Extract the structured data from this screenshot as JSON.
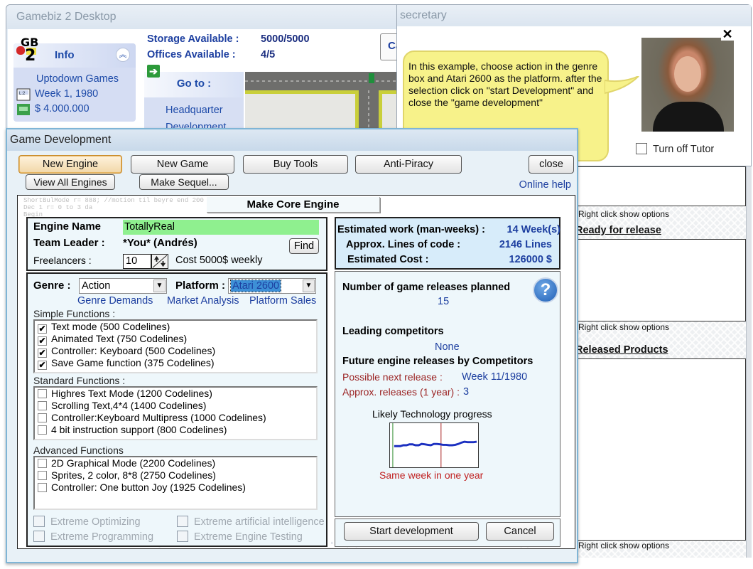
{
  "desktop": {
    "title": "Gamebiz 2 Desktop",
    "info": {
      "title": "Info",
      "company": "Uptodown Games",
      "date": "Week 1, 1980",
      "money": "$ 4.000.000"
    },
    "storage_label": "Storage Available :",
    "storage_value": "5000/5000",
    "offices_label": "Offices Available :",
    "offices_value": "4/5",
    "cal_button": "Ca",
    "goto": {
      "title": "Go to :",
      "items": [
        "Headquarter",
        "Development"
      ]
    }
  },
  "secretary": {
    "title": "secretary",
    "message": "In this example, choose action in the genre box and Atari 2600 as the platform. after the selection click on \"start Development\" and close the \"game development\"",
    "close": "✕",
    "tutor_toggle": "Turn off Tutor",
    "tutor_checked": false
  },
  "right_panel": {
    "hint": "Right click show options",
    "ready_title": "Ready for release",
    "released_title": "Released Products"
  },
  "game_dev": {
    "title": "Game Development",
    "toolbar": {
      "new_engine": "New Engine",
      "new_game": "New Game",
      "buy_tools": "Buy Tools",
      "anti_piracy": "Anti-Piracy",
      "close": "close",
      "view_all_engines": "View All Engines",
      "make_sequel": "Make Sequel...",
      "online_help": "Online help"
    },
    "section_title": "Make Core Engine",
    "engine": {
      "name_label": "Engine Name",
      "name_value": "TotallyReal",
      "leader_label": "Team Leader :",
      "leader_value": "*You* (Andrés)",
      "find": "Find",
      "freelancers_label": "Freelancers :",
      "freelancers_value": "10",
      "cost": "Cost 5000$ weekly"
    },
    "genre_label": "Genre :",
    "genre_value": "Action",
    "platform_label": "Platform :",
    "platform_value": "Atari 2600",
    "links": {
      "genre_demands": "Genre Demands",
      "market_analysis": "Market Analysis",
      "platform_sales": "Platform Sales"
    },
    "simple_label": "Simple Functions :",
    "simple": [
      {
        "label": "Text mode (500 Codelines)",
        "checked": true
      },
      {
        "label": "Animated Text (750 Codelines)",
        "checked": true
      },
      {
        "label": "Controller: Keyboard (500 Codelines)",
        "checked": true
      },
      {
        "label": "Save Game function (375 Codelines)",
        "checked": true
      }
    ],
    "standard_label": "Standard Functions :",
    "standard": [
      {
        "label": "Highres Text Mode (1200 Codelines)",
        "checked": false
      },
      {
        "label": "Scrolling Text,4*4 (1400 Codelines)",
        "checked": false
      },
      {
        "label": "Controller:Keyboard Multipress (1000 Codelines)",
        "checked": false
      },
      {
        "label": "4 bit instruction support (800 Codelines)",
        "checked": false
      }
    ],
    "advanced_label": "Advanced Functions",
    "advanced": [
      {
        "label": "2D Graphical Mode (2200 Codelines)",
        "checked": false
      },
      {
        "label": "Sprites, 2 color, 8*8 (2750 Codelines)",
        "checked": false
      },
      {
        "label": "Controller: One button Joy (1925 Codelines)",
        "checked": false
      }
    ],
    "extreme": {
      "optimizing": "Extreme Optimizing",
      "ai": "Extreme artificial intelligence",
      "programming": "Extreme Programming",
      "testing": "Extreme Engine Testing"
    },
    "estimates": {
      "work_label": "Estimated work (man-weeks) :",
      "work_value": "14 Week(s)",
      "lines_label": "Approx. Lines of code :",
      "lines_value": "2146 Lines",
      "cost_label": "Estimated Cost :",
      "cost_value": "126000 $"
    },
    "competition": {
      "releases_label": "Number of game releases planned",
      "releases_value": "15",
      "help": "?",
      "leading_label": "Leading competitors",
      "leading_value": "None",
      "future_label": "Future engine releases by Competitors",
      "next_label": "Possible next release :",
      "next_value": "Week 11/1980",
      "approx_label": "Approx. releases (1 year) :",
      "approx_value": "3",
      "chart_title": "Likely Technology progress",
      "chart_caption": "Same week in one year",
      "progress": [
        0.48,
        0.48,
        0.48,
        0.5,
        0.5,
        0.52,
        0.52,
        0.5,
        0.5,
        0.53,
        0.52,
        0.51,
        0.5,
        0.53,
        0.53,
        0.52,
        0.51,
        0.51,
        0.5,
        0.5,
        0.51,
        0.53,
        0.56,
        0.58,
        0.57,
        0.57,
        0.57,
        0.58
      ]
    },
    "start_button": "Start development",
    "cancel_button": "Cancel"
  }
}
